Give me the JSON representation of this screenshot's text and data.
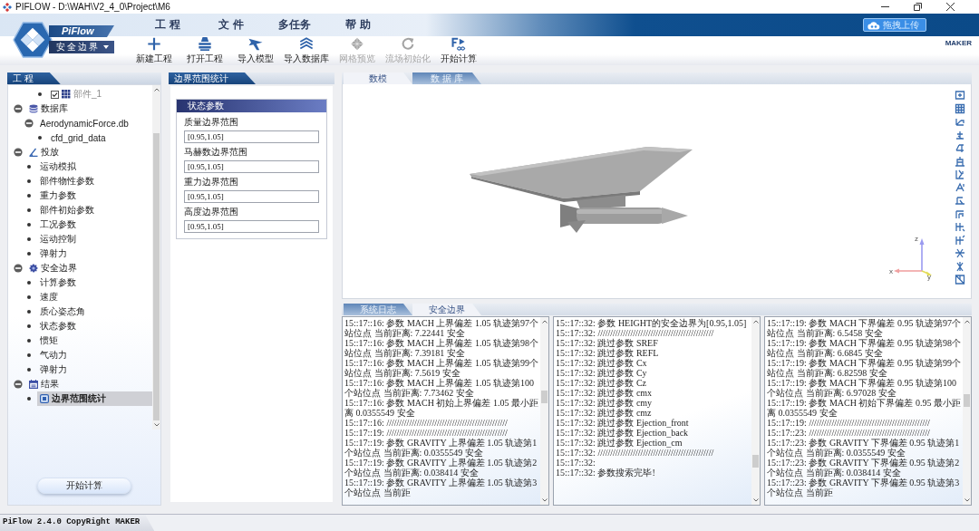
{
  "window": {
    "title": "PIFLOW - D:\\WAH\\V2_4_0\\Project\\M6"
  },
  "header": {
    "app_name": "PiFlow",
    "module": "安全边界",
    "menu": [
      {
        "label": "工 程"
      },
      {
        "label": "文 件"
      },
      {
        "label": "多任务"
      },
      {
        "label": "帮 助"
      }
    ],
    "upload_button": "拖拽上传"
  },
  "toolbar": {
    "items": [
      {
        "kind": "new",
        "label": "新建工程",
        "disabled": false
      },
      {
        "kind": "open",
        "label": "打开工程",
        "disabled": false
      },
      {
        "kind": "model",
        "label": "导入模型",
        "disabled": false
      },
      {
        "kind": "database",
        "label": "导入数据库",
        "disabled": false
      },
      {
        "kind": "mesh",
        "label": "网格预览",
        "disabled": true
      },
      {
        "kind": "reset",
        "label": "流场初始化",
        "disabled": true
      },
      {
        "kind": "run",
        "label": "开始计算",
        "disabled": false
      }
    ],
    "brand": "MAKER"
  },
  "project_panel": {
    "title": "工 程",
    "tree": [
      {
        "children": [
          {
            "children": [
              {
                "kind": "part",
                "label": "部件_1",
                "checked": true,
                "disabled": true,
                "selected": false
              }
            ]
          }
        ]
      },
      {
        "kind": "database",
        "label": "数据库",
        "expanded": true,
        "selected": false,
        "children": [
          {
            "kind": "file",
            "label": "AerodynamicForce.db",
            "expanded": true,
            "selected": false,
            "children": [
              {
                "kind": "leaf",
                "label": "cfd_grid_data",
                "selected": false
              }
            ]
          }
        ]
      },
      {
        "kind": "drop",
        "label": "投放",
        "expanded": true,
        "selected": false,
        "children": [
          {
            "kind": "leaf",
            "label": "运动模拟",
            "selected": false
          },
          {
            "kind": "leaf",
            "label": "部件物性参数",
            "selected": false
          },
          {
            "kind": "leaf",
            "label": "重力参数",
            "selected": false
          },
          {
            "kind": "leaf",
            "label": "部件初始参数",
            "selected": false
          },
          {
            "kind": "leaf",
            "label": "工况参数",
            "selected": false
          },
          {
            "kind": "leaf",
            "label": "运动控制",
            "selected": false
          },
          {
            "kind": "leaf",
            "label": "弹射力",
            "selected": false
          }
        ]
      },
      {
        "kind": "shield",
        "label": "安全边界",
        "expanded": true,
        "selected": false,
        "children": [
          {
            "kind": "leaf",
            "label": "计算参数",
            "selected": false
          },
          {
            "kind": "leaf",
            "label": "速度",
            "selected": false
          },
          {
            "kind": "leaf",
            "label": "质心姿态角",
            "selected": false
          },
          {
            "kind": "leaf",
            "label": "状态参数",
            "selected": false
          },
          {
            "kind": "leaf",
            "label": "惯矩",
            "selected": false
          },
          {
            "kind": "leaf",
            "label": "气动力",
            "selected": false
          },
          {
            "kind": "leaf",
            "label": "弹射力",
            "selected": false
          }
        ]
      },
      {
        "kind": "report",
        "label": "结果",
        "expanded": true,
        "selected": false,
        "children": [
          {
            "kind": "stat",
            "label": "边界范围统计",
            "selected": true
          }
        ]
      }
    ],
    "run_button": "开始计算"
  },
  "stats_panel": {
    "title": "边界范围统计",
    "card_title": "状态参数",
    "fields": [
      {
        "label": "质量边界范围",
        "value": "[0.95,1.05]"
      },
      {
        "label": "马赫数边界范围",
        "value": "[0.95,1.05]"
      },
      {
        "label": "重力边界范围",
        "value": "[0.95,1.05]"
      },
      {
        "label": "高度边界范围",
        "value": "[0.95,1.05]"
      }
    ]
  },
  "view_tabs": [
    {
      "label": "数模",
      "selected": true
    },
    {
      "label": "数 据 库",
      "selected": false
    }
  ],
  "viewport": {
    "axes": [
      {
        "label": "z"
      },
      {
        "label": "x"
      },
      {
        "label": "y"
      }
    ]
  },
  "log_tabs": [
    {
      "label": "系统日志",
      "selected": false
    },
    {
      "label": "安全边界",
      "selected": true
    }
  ],
  "log_panes": [
    {
      "lines": [
        "15::17::16: 参数 MACH 上界偏差 1.05 轨迹第97个站位点 当前距离: 7.22441 安全",
        "15::17::16: 参数 MACH 上界偏差 1.05 轨迹第98个站位点 当前距离: 7.39181 安全",
        "15::17::16: 参数 MACH 上界偏差 1.05 轨迹第99个站位点 当前距离: 7.5619 安全",
        "15::17::16: 参数 MACH 上界偏差 1.05 轨迹第100个站位点 当前距离: 7.73462 安全",
        "15::17::16: 参数 MACH 初始上界偏差 1.05 最小距离 0.0355549 安全",
        "15::17::16: ////////////////////////////////////////////////",
        "15::17::19: ////////////////////////////////////////////////",
        "15::17::19: 参数 GRAVITY 上界偏差 1.05 轨迹第1个站位点 当前距离: 0.0355549 安全",
        "15::17::19: 参数 GRAVITY 上界偏差 1.05 轨迹第2个站位点 当前距离: 0.038414 安全",
        "15::17::19: 参数 GRAVITY 上界偏差 1.05 轨迹第3个站位点 当前距"
      ]
    },
    {
      "lines": [
        "15::17::32: 参数 HEIGHT的安全边界为[0.95,1.05]",
        "15::17::32: //////////////////////////////////////////////",
        "15::17::32: 跳过参数 SREF",
        "15::17::32: 跳过参数 REFL",
        "15::17::32: 跳过参数 Cx",
        "15::17::32: 跳过参数 Cy",
        "15::17::32: 跳过参数 Cz",
        "15::17::32: 跳过参数 cmx",
        "15::17::32: 跳过参数 cmy",
        "15::17::32: 跳过参数 cmz",
        "15::17::32: 跳过参数 Ejection_front",
        "15::17::32: 跳过参数 Ejection_back",
        "15::17::32: 跳过参数 Ejection_cm",
        "15::17::32: //////////////////////////////////////////////",
        "15::17::32:",
        "15::17::32: 参数搜索完毕!"
      ]
    },
    {
      "lines": [
        "15::17::19: 参数 MACH 下界偏差 0.95 轨迹第97个站位点 当前距离: 6.5458 安全",
        "15::17::19: 参数 MACH 下界偏差 0.95 轨迹第98个站位点 当前距离: 6.6845 安全",
        "15::17::19: 参数 MACH 下界偏差 0.95 轨迹第99个站位点 当前距离: 6.82598 安全",
        "15::17::19: 参数 MACH 下界偏差 0.95 轨迹第100个站位点 当前距离: 6.97028 安全",
        "15::17::19: 参数 MACH 初始下界偏差 0.95 最小距离 0.0355549 安全",
        "15::17::19: ////////////////////////////////////////////////",
        "15::17::23: ////////////////////////////////////////////////",
        "15::17::23: 参数 GRAVITY 下界偏差 0.95 轨迹第1个站位点 当前距离: 0.0355549 安全",
        "15::17::23: 参数 GRAVITY 下界偏差 0.95 轨迹第2个站位点 当前距离: 0.038414 安全",
        "15::17::23: 参数 GRAVITY 下界偏差 0.95 轨迹第3个站位点 当前距"
      ]
    }
  ],
  "status_bar": {
    "text": "PiFlow 2.4.0 CopyRight MAKER"
  }
}
